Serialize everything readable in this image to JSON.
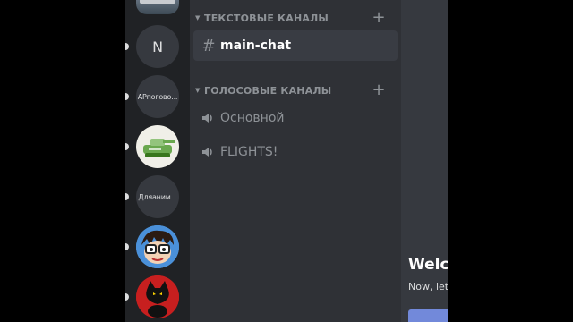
{
  "servers": [
    {
      "id": "top",
      "label": ""
    },
    {
      "id": "n",
      "label": "N"
    },
    {
      "id": "ap",
      "label": "АРпогово..."
    },
    {
      "id": "tank",
      "label": ""
    },
    {
      "id": "dl",
      "label": "Дляаним..."
    },
    {
      "id": "avatar",
      "label": ""
    },
    {
      "id": "cat",
      "label": ""
    }
  ],
  "categories": {
    "text": {
      "label": "ТЕКСТОВЫЕ КАНАЛЫ"
    },
    "voice": {
      "label": "ГОЛОСОВЫЕ КАНАЛЫ"
    }
  },
  "channels": {
    "text": [
      {
        "name": "main-chat",
        "icon": "hash-icon",
        "active": true
      }
    ],
    "voice": [
      {
        "name": "Основной",
        "icon": "speaker-icon"
      },
      {
        "name": "FLIGHTS!",
        "icon": "speaker-icon"
      }
    ]
  },
  "main": {
    "welcome_title": "Welco",
    "welcome_sub": "Now, let"
  },
  "colors": {
    "rail": "#202225",
    "sidebar": "#2f3136",
    "main": "#36393f",
    "accent": "#7289da"
  }
}
